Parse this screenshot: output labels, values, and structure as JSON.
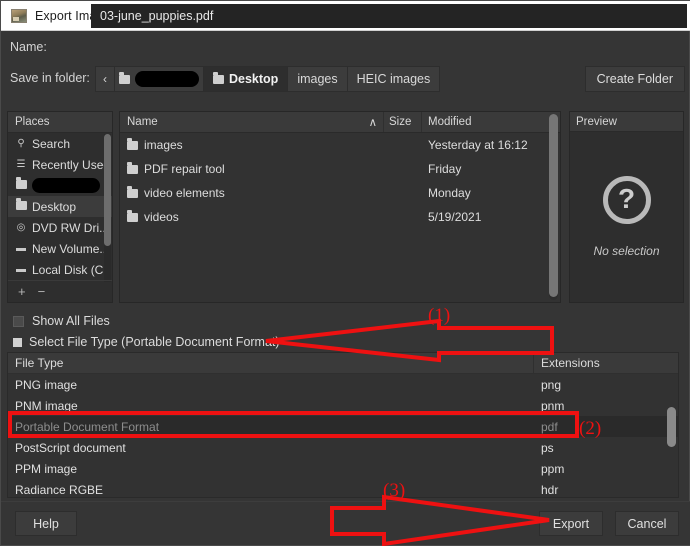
{
  "window": {
    "title": "Export Image",
    "icon": "image-thumbnail-icon",
    "close_label": "✕"
  },
  "name_row": {
    "label": "Name:",
    "value": "03-june_puppies.pdf",
    "placeholder": "Name"
  },
  "folder_row": {
    "label": "Save in folder:",
    "back_chevron": "‹",
    "crumbs": [
      {
        "label": "",
        "redacted": true,
        "active": false
      },
      {
        "label": "Desktop",
        "redacted": false,
        "active": true
      },
      {
        "label": "images",
        "redacted": false,
        "active": false
      },
      {
        "label": "HEIC images",
        "redacted": false,
        "active": false
      }
    ],
    "create_folder": "Create Folder"
  },
  "places": {
    "header": "Places",
    "items": [
      {
        "label": "Search",
        "icon": "search-icon",
        "glyph": "⚲",
        "redacted": false,
        "selected": false
      },
      {
        "label": "Recently Used",
        "icon": "recent-icon",
        "glyph": "☰",
        "redacted": false,
        "selected": false
      },
      {
        "label": "",
        "icon": "folder-icon",
        "glyph": "▮",
        "redacted": true,
        "selected": false
      },
      {
        "label": "Desktop",
        "icon": "folder-icon",
        "glyph": "▮",
        "redacted": false,
        "selected": true
      },
      {
        "label": "DVD RW Dri...",
        "icon": "disc-icon",
        "glyph": "◎",
        "redacted": false,
        "selected": false
      },
      {
        "label": "New Volume...",
        "icon": "drive-icon",
        "glyph": "▬",
        "redacted": false,
        "selected": false
      },
      {
        "label": "Local Disk (C:)",
        "icon": "drive-icon",
        "glyph": "▬",
        "redacted": false,
        "selected": false
      }
    ],
    "add_label": "+",
    "remove_label": "−"
  },
  "filelist": {
    "columns": [
      "Name",
      "Size",
      "Modified"
    ],
    "sort_indicator": "∧",
    "rows": [
      {
        "name": "images",
        "size": "",
        "modified": "Yesterday at 16:12"
      },
      {
        "name": "PDF repair tool",
        "size": "",
        "modified": "Friday"
      },
      {
        "name": "video elements",
        "size": "",
        "modified": "Monday"
      },
      {
        "name": "videos",
        "size": "",
        "modified": "5/19/2021"
      }
    ]
  },
  "preview": {
    "header": "Preview",
    "icon": "question-mark-icon",
    "icon_glyph": "?",
    "empty_text": "No selection"
  },
  "options": {
    "show_all_files": "Show All Files",
    "show_all_files_checked": false,
    "select_file_type": "Select File Type (Portable Document Format)",
    "expanded": true
  },
  "typetable": {
    "columns": [
      "File Type",
      "Extensions"
    ],
    "rows": [
      {
        "type": "PNG image",
        "ext": "png",
        "selected": false
      },
      {
        "type": "PNM image",
        "ext": "pnm",
        "selected": false
      },
      {
        "type": "Portable Document Format",
        "ext": "pdf",
        "selected": true
      },
      {
        "type": "PostScript document",
        "ext": "ps",
        "selected": false
      },
      {
        "type": "PPM image",
        "ext": "ppm",
        "selected": false
      },
      {
        "type": "Radiance RGBE",
        "ext": "hdr",
        "selected": false
      }
    ]
  },
  "footer": {
    "help": "Help",
    "export": "Export",
    "cancel": "Cancel"
  },
  "annotations": {
    "color": "#ee1111",
    "markers": [
      {
        "id": "1",
        "text": "(1)",
        "target": "select-file-type-row"
      },
      {
        "id": "2",
        "text": "(2)",
        "target": "portable-document-format-row"
      },
      {
        "id": "3",
        "text": "(3)",
        "target": "export-button"
      }
    ]
  }
}
